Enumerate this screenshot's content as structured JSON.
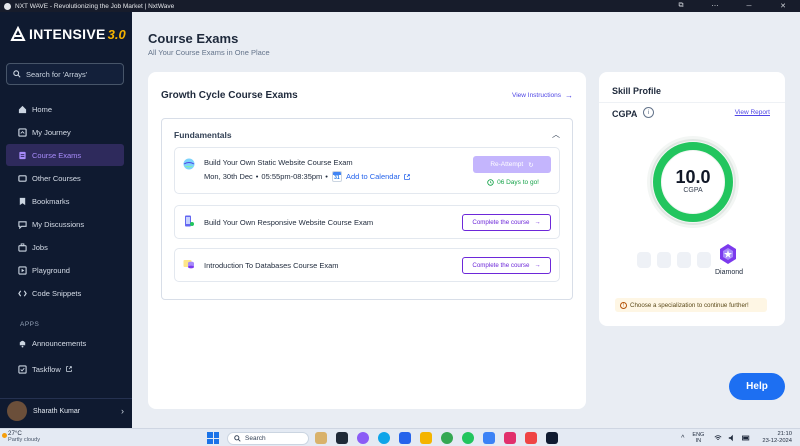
{
  "window": {
    "title": "NXT WAVE - Revolutionizing the Job Market | NxtWave",
    "controls": [
      "⧉",
      "⋯",
      "─",
      "✕"
    ]
  },
  "sidebar": {
    "logo_text": "INTENSIVE",
    "logo_version": "3.0",
    "search_placeholder": "Search for 'Arrays'",
    "items": [
      {
        "label": "Home",
        "icon": "home-icon"
      },
      {
        "label": "My Journey",
        "icon": "journey-icon"
      },
      {
        "label": "Course Exams",
        "icon": "exam-icon",
        "active": true
      },
      {
        "label": "Other Courses",
        "icon": "courses-icon"
      },
      {
        "label": "Bookmarks",
        "icon": "bookmark-icon"
      },
      {
        "label": "My Discussions",
        "icon": "discussion-icon"
      },
      {
        "label": "Jobs",
        "icon": "jobs-icon"
      },
      {
        "label": "Playground",
        "icon": "playground-icon"
      },
      {
        "label": "Code Snippets",
        "icon": "code-icon"
      }
    ],
    "apps_label": "APPS",
    "apps": [
      {
        "label": "Announcements",
        "icon": "bell-icon"
      },
      {
        "label": "Taskflow",
        "icon": "taskflow-icon"
      }
    ],
    "user_name": "Sharath Kumar"
  },
  "header": {
    "title": "Course Exams",
    "subtitle": "All Your Course Exams in One Place"
  },
  "exams_card": {
    "title": "Growth Cycle Course Exams",
    "view_instructions": "View Instructions",
    "section_title": "Fundamentals",
    "exams": [
      {
        "name": "Build Your Own Static Website Course Exam",
        "date": "Mon, 30th Dec",
        "time": "05:55pm-08:35pm",
        "add_to_calendar": "Add to Calendar",
        "calendar_day": "31",
        "action": "Re-Attempt",
        "days_left": "06 Days to go!"
      },
      {
        "name": "Build Your Own Responsive Website Course Exam",
        "action": "Complete the course"
      },
      {
        "name": "Introduction To Databases Course Exam",
        "action": "Complete the course"
      }
    ]
  },
  "skill_profile": {
    "title": "Skill Profile",
    "cgpa_label": "CGPA",
    "view_report": "View Report",
    "cgpa_value": "10.0",
    "gauge_label": "CGPA",
    "gauge_fraction": 1.0,
    "badge_name": "Diamond",
    "warning": "Choose a specialization to continue further!"
  },
  "help_button": "Help",
  "taskbar": {
    "temperature": "27°C",
    "condition": "Partly cloudy",
    "search_label": "Search",
    "language_line1": "ENG",
    "language_line2": "IN",
    "time": "21:10",
    "date": "23-12-2024"
  },
  "colors": {
    "sidebar_bg": "#0f1a30",
    "accent_purple": "#6d28d9",
    "gauge_green": "#22c55e",
    "help_blue": "#1d6ff2"
  }
}
